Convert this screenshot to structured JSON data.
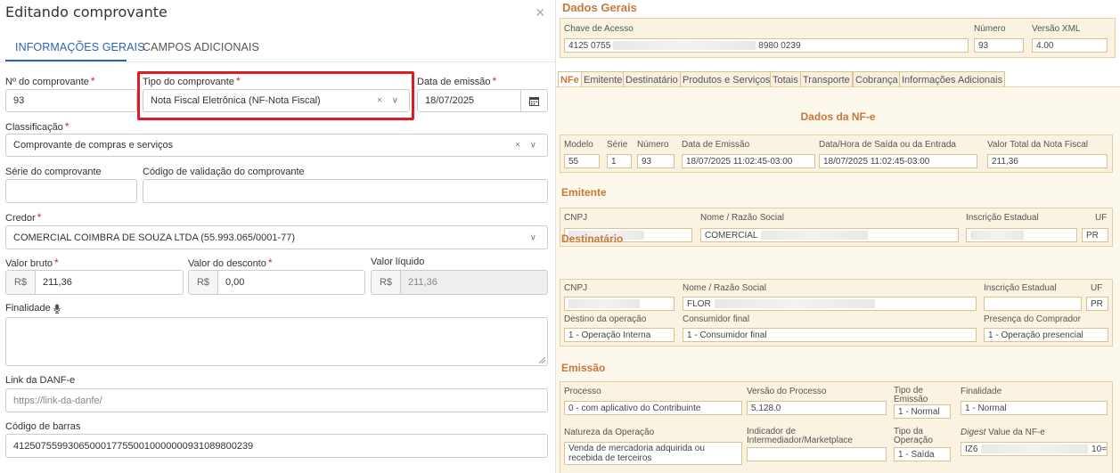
{
  "left": {
    "title": "Editando comprovante",
    "close": "×",
    "tabs": [
      "INFORMAÇÕES GERAIS",
      "CAMPOS ADICIONAIS"
    ],
    "numero_label": "Nº do comprovante",
    "numero_value": "93",
    "tipo_label": "Tipo do comprovante",
    "tipo_value": "Nota Fiscal Eletrônica (NF-Nota Fiscal)",
    "data_label": "Data de emissão",
    "data_value": "18/07/2025",
    "classificacao_label": "Classificação",
    "classificacao_value": "Comprovante de compras e serviços",
    "serie_label": "Série do comprovante",
    "codigo_validacao_label": "Código de validação do comprovante",
    "credor_label": "Credor",
    "credor_value": "COMERCIAL COIMBRA DE SOUZA LTDA (55.993.065/0001-77)",
    "valor_bruto_label": "Valor bruto",
    "valor_bruto_value": "211,36",
    "valor_desconto_label": "Valor do desconto",
    "valor_desconto_value": "0,00",
    "valor_liquido_label": "Valor líquido",
    "valor_liquido_value": "211,36",
    "currency": "R$",
    "finalidade_label": "Finalidade",
    "link_label": "Link da DANF-e",
    "link_placeholder": "https://link-da-danfe/",
    "barcode_label": "Código de barras",
    "barcode_value": "41250755993065000177550010000000931089800239",
    "select_icons": "× ∨",
    "credor_icon": "∨"
  },
  "right": {
    "dados_gerais": "Dados Gerais",
    "chave_label": "Chave de Acesso",
    "chave_start": "4125 0755",
    "chave_end": "8980 0239",
    "numero_label": "Número",
    "numero_value": "93",
    "versao_label": "Versão XML",
    "versao_value": "4.00",
    "tabs": [
      "NFe",
      "Emitente",
      "Destinatário",
      "Produtos e Serviços",
      "Totais",
      "Transporte",
      "Cobrança",
      "Informações Adicionais"
    ],
    "dados_nfe": "Dados da NF-e",
    "modelo_label": "Modelo",
    "modelo_value": "55",
    "serie_label": "Série",
    "serie_value": "1",
    "numero2_label": "Número",
    "numero2_value": "93",
    "data_emissao_label": "Data de Emissão",
    "data_emissao_value": "18/07/2025 11:02:45-03:00",
    "data_saida_label": "Data/Hora de Saída ou da Entrada",
    "data_saida_value": "18/07/2025 11:02:45-03:00",
    "valor_total_label": "Valor Total da Nota Fiscal",
    "valor_total_value": "211,36",
    "emitente_h": "Emitente",
    "cnpj_label": "CNPJ",
    "nome_label": "Nome / Razão Social",
    "emitente_nome": "COMERCIAL",
    "ie_label": "Inscrição Estadual",
    "uf_label": "UF",
    "emitente_uf": "PR",
    "destinatario_h": "Destinatário",
    "dest_nome": "FLOR",
    "dest_uf": "PR",
    "destino_label": "Destino da operação",
    "destino_value": "1 - Operação Interna",
    "consumidor_label": "Consumidor final",
    "consumidor_value": "1 - Consumidor final",
    "presenca_label": "Presença do Comprador",
    "presenca_value": "1 - Operação presencial",
    "emissao_h": "Emissão",
    "processo_label": "Processo",
    "processo_value": "0 - com aplicativo do Contribuinte",
    "versao_proc_label": "Versão do Processo",
    "versao_proc_value": "5.128.0",
    "tipo_emissao_label": "Tipo de Emissão",
    "tipo_emissao_value": "1 - Normal",
    "finalidade_label": "Finalidade",
    "finalidade_value": "1 - Normal",
    "natureza_label": "Natureza da Operação",
    "natureza_value": "Venda de mercadoria adquirida ou recebida de terceiros",
    "indicador_label": "Indicador de Intermediador/Marketplace",
    "tipo_operacao_label": "Tipo da Operação",
    "tipo_operacao_value": "1 - Saída",
    "digest_label_italic": "Digest",
    "digest_label_rest": " Value da NF-e",
    "digest_start": "IZ6",
    "digest_end": "10="
  }
}
